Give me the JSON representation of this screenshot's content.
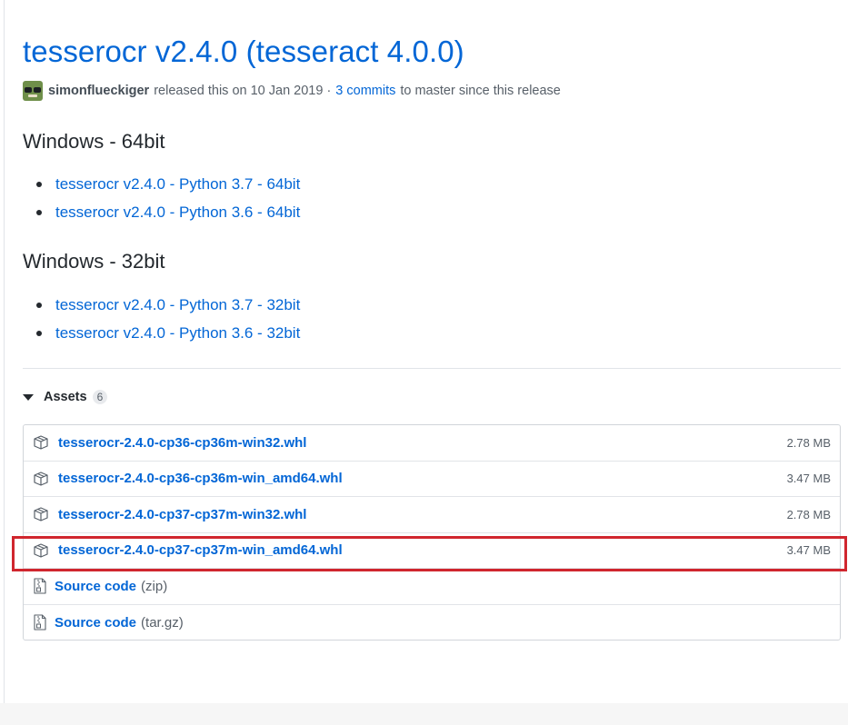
{
  "release": {
    "title": "tesserocr v2.4.0 (tesseract 4.0.0)",
    "author": "simonflueckiger",
    "released_text": "released this on 10 Jan 2019 ·",
    "commits_link": "3 commits",
    "since_text": "to master since this release"
  },
  "sections": [
    {
      "heading": "Windows - 64bit",
      "links": [
        "tesserocr v2.4.0 - Python 3.7 - 64bit",
        "tesserocr v2.4.0 - Python 3.6 - 64bit"
      ]
    },
    {
      "heading": "Windows - 32bit",
      "links": [
        "tesserocr v2.4.0 - Python 3.7 - 32bit",
        "tesserocr v2.4.0 - Python 3.6 - 32bit"
      ]
    }
  ],
  "assets": {
    "label": "Assets",
    "count": "6",
    "files": [
      {
        "name": "tesserocr-2.4.0-cp36-cp36m-win32.whl",
        "size": "2.78 MB",
        "icon": "package-icon"
      },
      {
        "name": "tesserocr-2.4.0-cp36-cp36m-win_amd64.whl",
        "size": "3.47 MB",
        "icon": "package-icon"
      },
      {
        "name": "tesserocr-2.4.0-cp37-cp37m-win32.whl",
        "size": "2.78 MB",
        "icon": "package-icon"
      },
      {
        "name": "tesserocr-2.4.0-cp37-cp37m-win_amd64.whl",
        "size": "3.47 MB",
        "icon": "package-icon",
        "highlighted": true
      }
    ],
    "source": [
      {
        "label": "Source code",
        "format": "(zip)",
        "icon": "file-zip-icon"
      },
      {
        "label": "Source code",
        "format": "(tar.gz)",
        "icon": "file-zip-icon"
      }
    ]
  },
  "colors": {
    "link": "#0366d6",
    "highlight": "#d0262e",
    "text": "#24292e",
    "muted": "#586069"
  }
}
